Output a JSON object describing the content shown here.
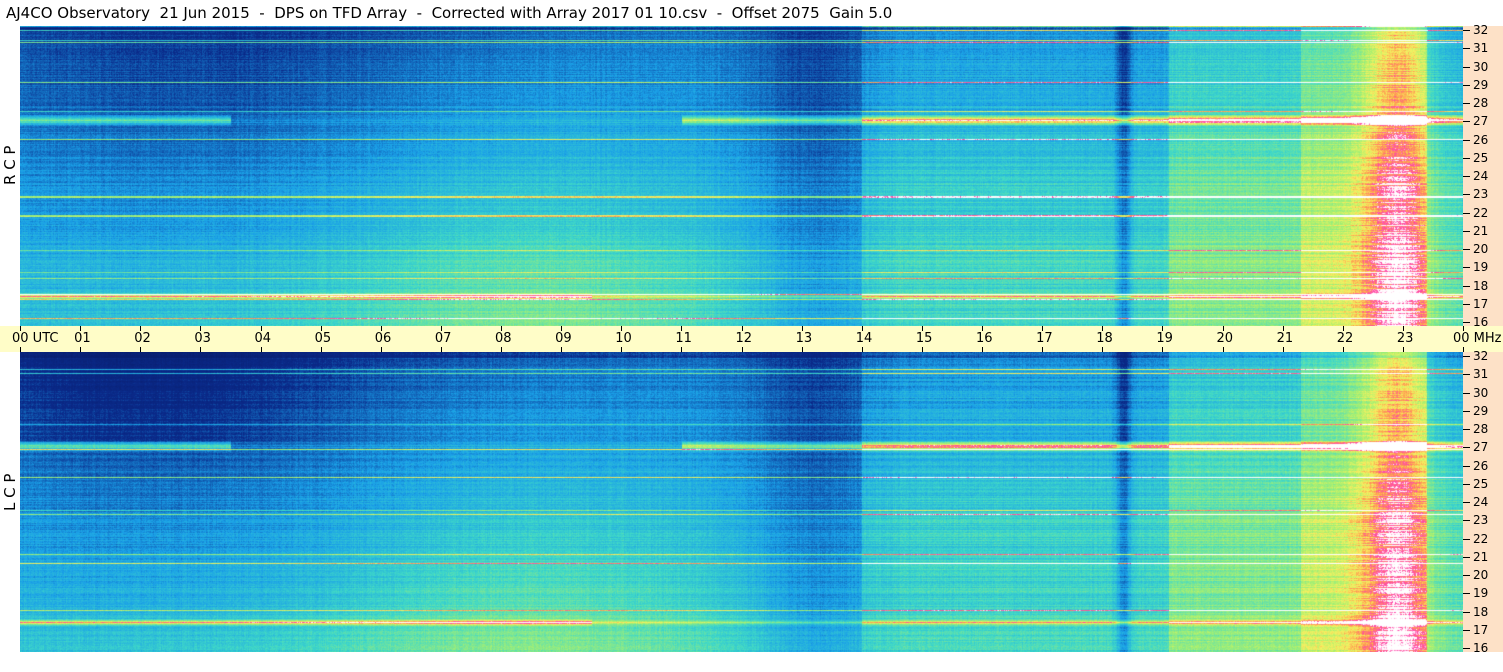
{
  "title": "AJ4CO Observatory  21 Jun 2015  -  DPS on TFD Array  -  Corrected with Array 2017 01 10.csv  -  Offset 2075  Gain 5.0",
  "chart_data": [
    {
      "type": "heatmap",
      "channel_label": "R C P",
      "x_ticks": [
        "00 UTC",
        "01",
        "02",
        "03",
        "04",
        "05",
        "06",
        "07",
        "08",
        "09",
        "10",
        "11",
        "12",
        "13",
        "14",
        "15",
        "16",
        "17",
        "18",
        "19",
        "20",
        "21",
        "22",
        "23",
        "00 MHz"
      ],
      "y_ticks": [
        "32",
        "31",
        "30",
        "29",
        "28",
        "27",
        "26",
        "25",
        "24",
        "23",
        "22",
        "21",
        "20",
        "19",
        "18",
        "17",
        "16"
      ],
      "y_range": [
        16,
        32
      ],
      "x_range": [
        0,
        24
      ],
      "colors": {
        "low": "#0a2a8a",
        "mid": "#1aa0e8",
        "midhigh": "#3fd8c8",
        "high": "#f6f060",
        "peak": "#ff44aa",
        "saturated": "#ffffff"
      }
    },
    {
      "type": "heatmap",
      "channel_label": "L C P",
      "x_ticks": [
        "00 UTC",
        "01",
        "02",
        "03",
        "04",
        "05",
        "06",
        "07",
        "08",
        "09",
        "10",
        "11",
        "12",
        "13",
        "14",
        "15",
        "16",
        "17",
        "18",
        "19",
        "20",
        "21",
        "22",
        "23",
        "00 MHz"
      ],
      "y_ticks": [
        "32",
        "31",
        "30",
        "29",
        "28",
        "27",
        "26",
        "25",
        "24",
        "23",
        "22",
        "21",
        "20",
        "19",
        "18",
        "17",
        "16"
      ],
      "y_range": [
        16,
        32
      ],
      "x_range": [
        0,
        24
      ],
      "colors": {
        "low": "#0a2a8a",
        "mid": "#1aa0e8",
        "midhigh": "#3fd8c8",
        "high": "#f6f060",
        "peak": "#ff44aa",
        "saturated": "#ffffff"
      }
    }
  ]
}
